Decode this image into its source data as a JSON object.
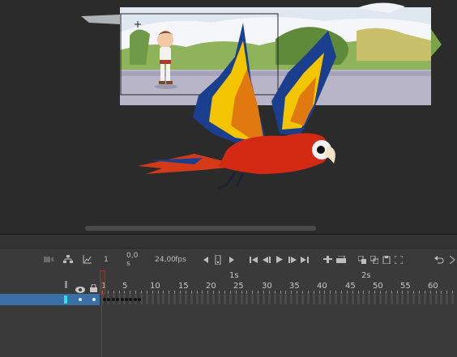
{
  "toolbar": {
    "current_frame": "1",
    "time": "0,0 s",
    "fps": "24,00",
    "fps_unit": "fps"
  },
  "ruler": {
    "seconds": [
      "1s",
      "2s"
    ],
    "frames": [
      "1",
      "5",
      "10",
      "15",
      "20",
      "25",
      "30",
      "35",
      "40",
      "45",
      "50",
      "55",
      "60"
    ]
  },
  "layer": {
    "keyframe_count": 9
  },
  "colors": {
    "selection_blue": "#3b6fa8",
    "playhead_red": "#c02020",
    "layer_cyan": "#2fe0e0"
  }
}
